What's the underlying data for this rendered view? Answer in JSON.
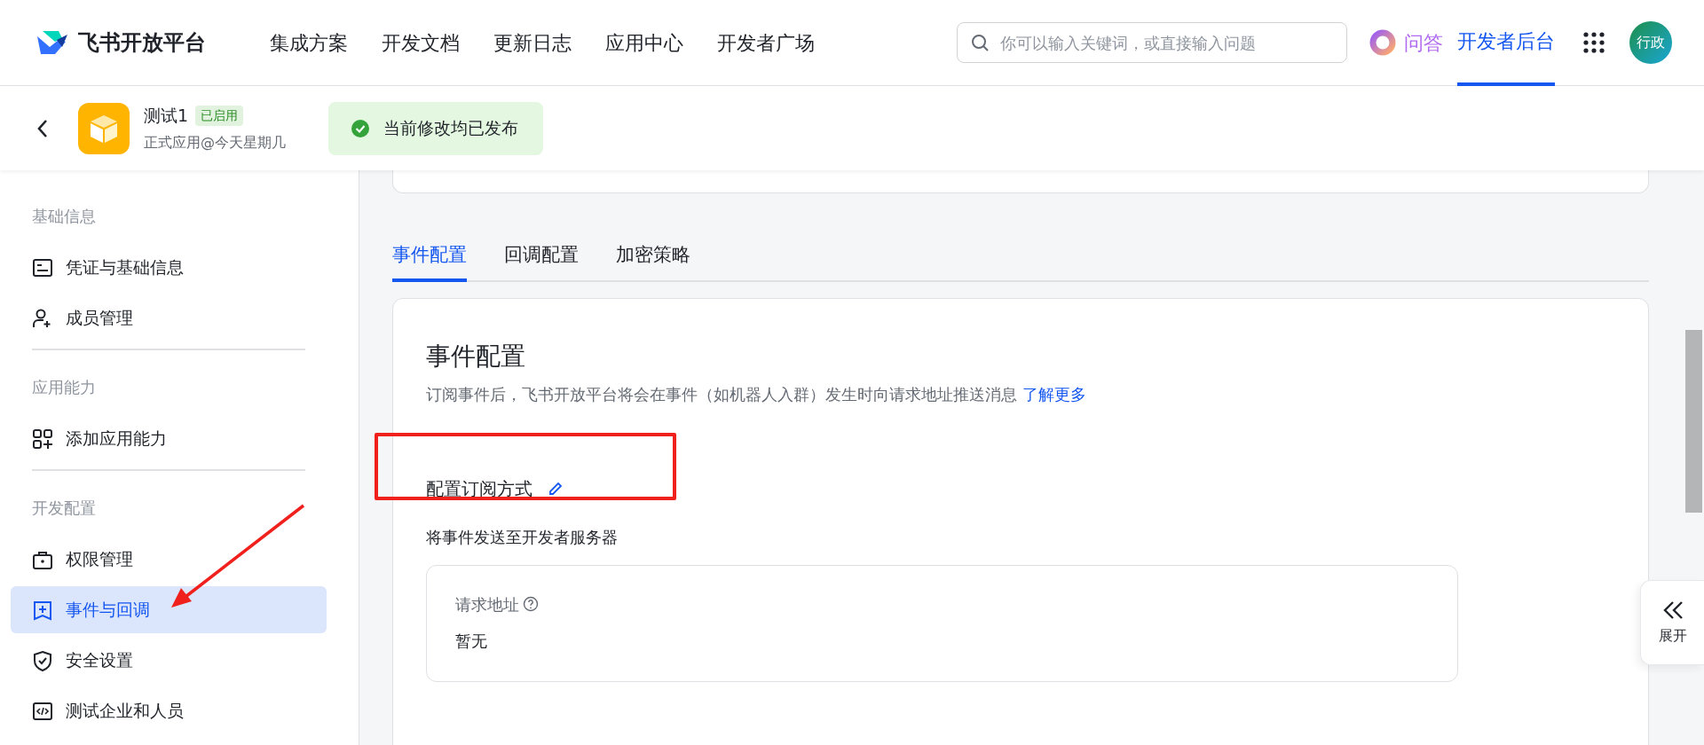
{
  "brand": {
    "name": "飞书开放平台"
  },
  "nav": [
    {
      "label": "集成方案"
    },
    {
      "label": "开发文档"
    },
    {
      "label": "更新日志"
    },
    {
      "label": "应用中心"
    },
    {
      "label": "开发者广场"
    }
  ],
  "search": {
    "placeholder": "你可以输入关键词，或直接输入问题"
  },
  "ask": {
    "label": "问答"
  },
  "console": {
    "label": "开发者后台",
    "selected": true
  },
  "avatar": {
    "text": "行政"
  },
  "app": {
    "name": "测试1",
    "status": "已启用",
    "subtitle": "正式应用@今天星期几"
  },
  "notice": {
    "text": "当前修改均已发布"
  },
  "sidebar": [
    {
      "title": "基础信息",
      "items": [
        {
          "label": "凭证与基础信息",
          "selected": false
        },
        {
          "label": "成员管理",
          "selected": false
        }
      ]
    },
    {
      "title": "应用能力",
      "items": [
        {
          "label": "添加应用能力",
          "selected": false
        }
      ]
    },
    {
      "title": "开发配置",
      "items": [
        {
          "label": "权限管理",
          "selected": false
        },
        {
          "label": "事件与回调",
          "selected": true
        },
        {
          "label": "安全设置",
          "selected": false
        },
        {
          "label": "测试企业和人员",
          "selected": false
        }
      ]
    }
  ],
  "tabs": [
    {
      "label": "事件配置",
      "selected": true
    },
    {
      "label": "回调配置",
      "selected": false
    },
    {
      "label": "加密策略",
      "selected": false
    }
  ],
  "card": {
    "title": "事件配置",
    "description": "订阅事件后，飞书开放平台将会在事件（如机器人入群）发生时向请求地址推送消息",
    "link": "了解更多",
    "section_title": "配置订阅方式",
    "section_subtitle": "将事件发送至开发者服务器",
    "field_label": "请求地址",
    "field_value": "暂无"
  },
  "float_button": {
    "label": "展开"
  }
}
